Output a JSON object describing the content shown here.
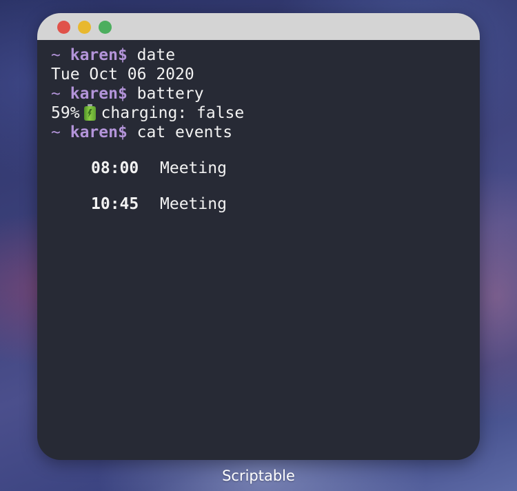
{
  "window": {
    "traffic_lights": {
      "close_color": "#e0524a",
      "minimize_color": "#e8b82f",
      "zoom_color": "#4cae5e"
    }
  },
  "terminal": {
    "prompt": {
      "tilde": "~",
      "user": "karen$"
    },
    "lines": [
      {
        "command": "date"
      },
      {
        "output": "Tue Oct 06 2020"
      },
      {
        "command": "battery"
      },
      {
        "battery_percent": "59%",
        "battery_icon": "battery-charging-icon",
        "charging_text": "charging: false"
      },
      {
        "command": "cat events"
      }
    ],
    "events": [
      {
        "time": "08:00",
        "title": "Meeting"
      },
      {
        "time": "10:45",
        "title": "Meeting"
      }
    ]
  },
  "app_label": "Scriptable",
  "colors": {
    "terminal_bg": "#272a35",
    "prompt_color": "#b394d9",
    "text_color": "#f2f2f2",
    "titlebar_bg": "#d4d4d4"
  }
}
